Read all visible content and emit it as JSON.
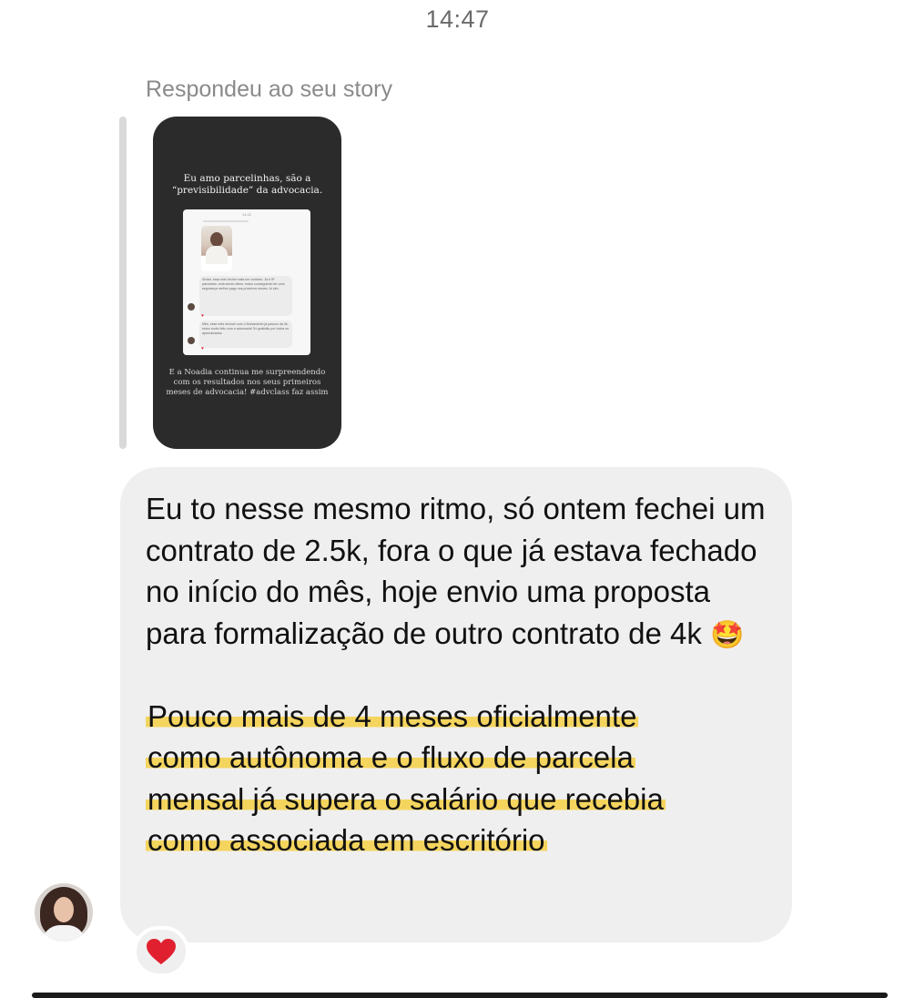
{
  "header": {
    "timestamp": "14:47"
  },
  "story_reply": {
    "label": "Respondeu ao seu story",
    "story": {
      "headline": "Eu amo parcelinhas, são a “previsibilidade” da advocacia.",
      "inner_time": "14:42",
      "inner_message_1": "Vivian, essa mês fechei mais um contrato. Já é 5ª parcelado, está sendo ótimo, estou conseguindo ter uma segurança melhor pago nos próximos meses. Aí sim.",
      "inner_message_2": "Mês, esse mês renovei com o fechamento já passou da 4k, estou muito feliz com a advocacia! Só gratidão por todos os aprendizados",
      "caption": "E a Noadia continua me surpreendendo com os resultados nos seus primeiros meses de advocacia! #advclass faz assim"
    }
  },
  "message": {
    "paragraph_1": "Eu to nesse mesmo ritmo, só ontem fechei um contrato de 2.5k, fora o que já estava fechado no início do mês, hoje envio uma proposta para formalização de outro contrato de 4k",
    "emoji": "🤩",
    "highlighted_lines": [
      "Pouco mais de 4 meses oficialmente",
      "como autônoma e o fluxo de parcela",
      "mensal já supera o salário que recebia",
      "como associada em escritório"
    ],
    "highlight_color": "#f5d044",
    "bubble_color": "#efefef"
  },
  "reaction": {
    "icon": "heart-icon",
    "color": "#e0202e"
  }
}
